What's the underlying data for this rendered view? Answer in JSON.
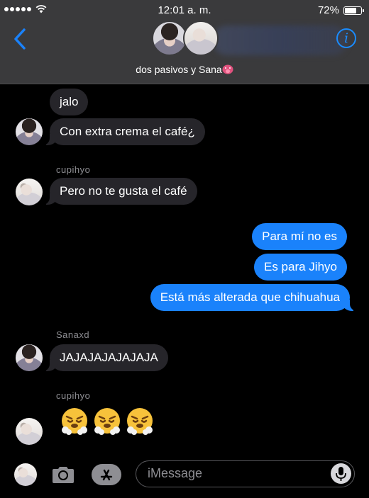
{
  "status_bar": {
    "time": "12:01 a. m.",
    "battery": "72%",
    "battery_level": 0.72
  },
  "header": {
    "group_name": "dos pasivos y Sana",
    "group_emoji": "tongue-face-emoji",
    "back_icon": "chevron-left-icon",
    "info_icon": "info-icon",
    "accent_color": "#1a82fb"
  },
  "messages": {
    "m1": "jalo",
    "m2": "Con extra crema el café¿",
    "sender_cupihyo_1": "cupihyo",
    "m3": "Pero no te gusta el café",
    "m4": "Para mí no es",
    "m5": "Es para Jihyo",
    "m6": "Está más alterada que chihuahua",
    "sender_sanaxd": "Sanaxd",
    "m7": "JAJAJAJAJAJAJA",
    "sender_cupihyo_2": "cupihyo",
    "emoji_reply": [
      "face-with-steam-emoji",
      "face-with-steam-emoji",
      "face-with-steam-emoji"
    ]
  },
  "input_bar": {
    "placeholder": "iMessage",
    "camera_icon": "camera-icon",
    "appstore_icon": "app-store-icon",
    "mic_icon": "microphone-icon"
  }
}
